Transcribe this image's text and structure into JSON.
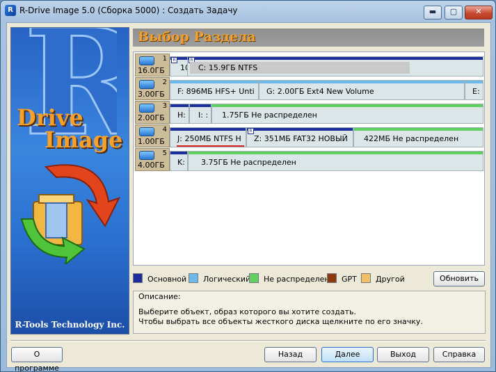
{
  "window": {
    "title": "R-Drive Image 5.0 (Сборка 5000) : Создать Задачу",
    "icon": "R",
    "minimize": "▬",
    "maximize": "▢",
    "close": "✕"
  },
  "banner": {
    "r_letter": "R",
    "drive": "Drive",
    "image": "Image",
    "company": "R-Tools Technology Inc."
  },
  "header": {
    "title": "Выбор Раздела"
  },
  "disks": [
    {
      "num": "1",
      "size": "16.0ГБ",
      "parts": [
        {
          "type": "primary",
          "label": "10"
        },
        {
          "type": "primary",
          "label": "C:  15.9ГБ  NTFS",
          "used": 0.72
        }
      ]
    },
    {
      "num": "2",
      "size": "3.00ГБ",
      "parts": [
        {
          "type": "logical",
          "label": "F:  896МБ  HFS+  Unti"
        },
        {
          "type": "logical",
          "label": "G:  2.00ГБ  Ext4  New Volume"
        },
        {
          "type": "logical",
          "label": "E:"
        }
      ]
    },
    {
      "num": "3",
      "size": "2.00ГБ",
      "parts": [
        {
          "type": "primary",
          "label": "H:"
        },
        {
          "type": "primary",
          "label": "I:  :"
        },
        {
          "type": "free",
          "label": "1.75ГБ  Не распределен"
        }
      ]
    },
    {
      "num": "4",
      "size": "1.00ГБ",
      "parts": [
        {
          "type": "primary",
          "label": "J:  250МБ  NTFS  Н"
        },
        {
          "type": "primary",
          "label": "Z:  351МБ  FAT32  НОВЫЙ"
        },
        {
          "type": "free",
          "label": "422МБ  Не распределен"
        }
      ]
    },
    {
      "num": "5",
      "size": "4.00ГБ",
      "parts": [
        {
          "type": "primary",
          "label": "K:"
        },
        {
          "type": "free",
          "label": "3.75ГБ  Не распределен"
        }
      ]
    }
  ],
  "legend": [
    {
      "label": "Основной",
      "color": "#1c2f9a"
    },
    {
      "label": "Логический",
      "color": "#6fb8ea"
    },
    {
      "label": "Не распределен",
      "color": "#5fd05f"
    },
    {
      "label": "GPT",
      "color": "#8b3a0e"
    },
    {
      "label": "Другой",
      "color": "#f2c068"
    }
  ],
  "buttons": {
    "refresh": "Обновить",
    "about": "О программе",
    "back": "Назад",
    "next": "Далее",
    "exit": "Выход",
    "help": "Справка"
  },
  "description": {
    "title": "Описание:",
    "line1": "Выберите объект, образ которого вы хотите создать.",
    "line2": "Чтобы выбрать все объекты жесткого диска щелкните по его значку."
  }
}
